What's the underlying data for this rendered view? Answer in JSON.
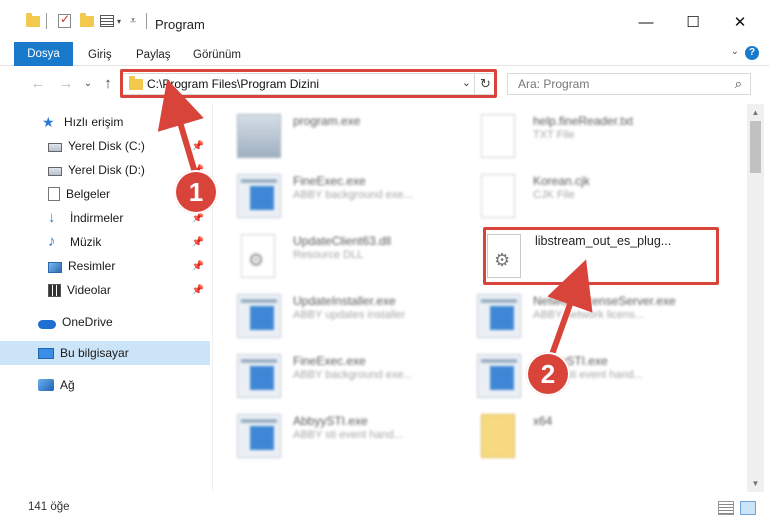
{
  "window": {
    "title": "Program",
    "minimize": "—",
    "maximize": "☐",
    "close": "✕"
  },
  "ribbon": {
    "tabs": [
      "Dosya",
      "Giriş",
      "Paylaş",
      "Görünüm"
    ],
    "expand": "⌄",
    "help": "?"
  },
  "nav": {
    "back": "←",
    "forward": "→",
    "recent": "⌄",
    "up": "↑",
    "address": "C:\\Program Files\\Program Dizini",
    "address_dropdown": "⌄",
    "refresh": "↻",
    "search_placeholder": "Ara: Program",
    "search_icon": "⌕"
  },
  "sidebar": {
    "items": [
      {
        "label": "Hızlı erişim",
        "icon": "star-icon",
        "pinned": false
      },
      {
        "label": "Yerel Disk (C:)",
        "icon": "drive-icon",
        "pinned": true
      },
      {
        "label": "Yerel Disk (D:)",
        "icon": "drive-icon",
        "pinned": true
      },
      {
        "label": "Belgeler",
        "icon": "documents-icon",
        "pinned": true
      },
      {
        "label": "İndirmeler",
        "icon": "download-icon",
        "pinned": true
      },
      {
        "label": "Müzik",
        "icon": "music-icon",
        "pinned": true
      },
      {
        "label": "Resimler",
        "icon": "pictures-icon",
        "pinned": true
      },
      {
        "label": "Videolar",
        "icon": "videos-icon",
        "pinned": true
      },
      {
        "label": "OneDrive",
        "icon": "cloud-icon",
        "pinned": false
      },
      {
        "label": "Bu bilgisayar",
        "icon": "computer-icon",
        "pinned": false,
        "selected": true
      },
      {
        "label": "Ağ",
        "icon": "network-icon",
        "pinned": false
      }
    ],
    "pin_glyph": "📌"
  },
  "files": [
    {
      "name": "program.exe",
      "desc": "",
      "icon": "setup-icon"
    },
    {
      "name": "help.fineReader.txt",
      "desc": "TXT File",
      "icon": "document-icon"
    },
    {
      "name": "FineExec.exe",
      "desc": "ABBY background exe...",
      "icon": "exe-icon"
    },
    {
      "name": "Korean.cjk",
      "desc": "CJK File",
      "icon": "document-icon"
    },
    {
      "name": "UpdateClient63.dll",
      "desc": "Resource DLL",
      "icon": "dll-icon"
    },
    {
      "name": "libstream_out_es_plug...",
      "desc": "",
      "icon": "dll-icon"
    },
    {
      "name": "UpdateInstaller.exe",
      "desc": "ABBY updates installer",
      "icon": "exe-icon"
    },
    {
      "name": "NetworkLicenseServer.exe",
      "desc": "ABBY network licens...",
      "icon": "exe-icon"
    },
    {
      "name": "FineExec.exe",
      "desc": "ABBY background exe...",
      "icon": "exe-icon"
    },
    {
      "name": "AbbyySTI.exe",
      "desc": "ABBY sti event hand...",
      "icon": "exe-icon"
    },
    {
      "name": "AbbyySTI.exe",
      "desc": "ABBY sti event hand...",
      "icon": "exe-icon"
    },
    {
      "name": "x64",
      "desc": "",
      "icon": "folder-icon"
    }
  ],
  "status": {
    "count": "141 öğe"
  },
  "annotations": {
    "step1": "1",
    "step2": "2",
    "color": "#d9443a"
  }
}
